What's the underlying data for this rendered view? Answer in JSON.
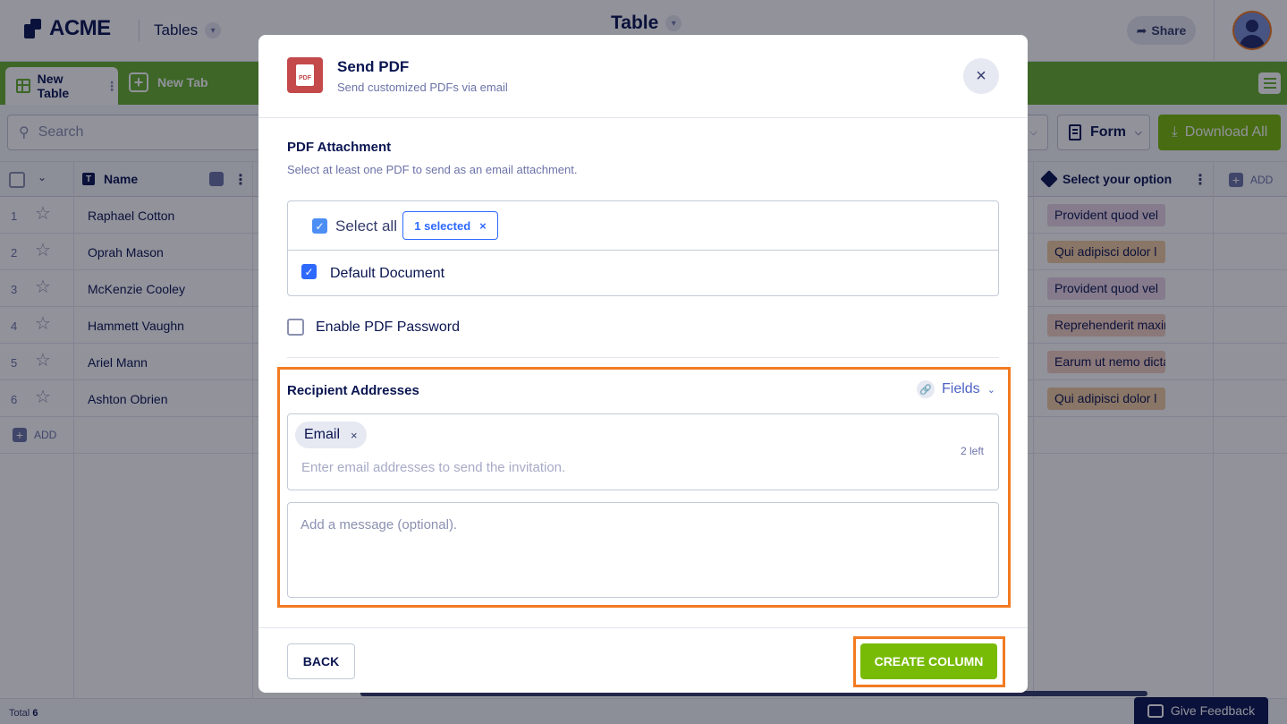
{
  "app": {
    "logo_text": "ACME",
    "tables_menu": "Tables",
    "page_title": "Table",
    "share_label": "Share"
  },
  "tabs": [
    {
      "label": "New Table",
      "active": true
    },
    {
      "label": "New Tab",
      "active": false
    }
  ],
  "toolbar": {
    "search_placeholder": "Search",
    "form_label": "Form",
    "download_label": "Download All"
  },
  "grid": {
    "columns": {
      "name": "Name",
      "option": "Select your option",
      "add": "ADD"
    },
    "rows": [
      {
        "num": "1",
        "name": "Raphael Cotton",
        "option": "Provident quod vel",
        "option_color": "#ead5e6"
      },
      {
        "num": "2",
        "name": "Oprah Mason",
        "option": "Qui adipisci dolor l",
        "option_color": "#f3cda0"
      },
      {
        "num": "3",
        "name": "McKenzie Cooley",
        "option": "Provident quod vel",
        "option_color": "#ead5e6"
      },
      {
        "num": "4",
        "name": "Hammett Vaughn",
        "option": "Reprehenderit maxime",
        "option_color": "#f5d0c4"
      },
      {
        "num": "5",
        "name": "Ariel Mann",
        "option": "Earum ut nemo dicta",
        "option_color": "#f5d0c4"
      },
      {
        "num": "6",
        "name": "Ashton Obrien",
        "option": "Qui adipisci dolor l",
        "option_color": "#f3cda0"
      }
    ],
    "add_row_label": "ADD",
    "total_label": "Total",
    "total_value": "6",
    "feedback_label": "Give Feedback"
  },
  "modal": {
    "title": "Send PDF",
    "subtitle": "Send customized PDFs via email",
    "pdf_icon_text": "PDF",
    "attachment": {
      "title": "PDF Attachment",
      "subtitle": "Select at least one PDF to send as an email attachment.",
      "select_all_label": "Select all",
      "selected_chip": "1 selected",
      "document_label": "Default Document",
      "document_checked": true
    },
    "password": {
      "label": "Enable PDF Password",
      "checked": false
    },
    "recipients": {
      "title": "Recipient Addresses",
      "fields_label": "Fields",
      "email_chip": "Email",
      "remaining": "2 left",
      "email_placeholder": "Enter email addresses to send the invitation.",
      "message_placeholder": "Add a message (optional)."
    },
    "footer": {
      "back_label": "BACK",
      "create_label": "CREATE COLUMN"
    }
  },
  "colors": {
    "brand_green": "#67b02e",
    "button_green": "#78bb07",
    "highlight_orange": "#f27b21",
    "checkbox_blue": "#2e69ff",
    "pdf_red": "#c3494a",
    "navy": "#0a1551"
  }
}
